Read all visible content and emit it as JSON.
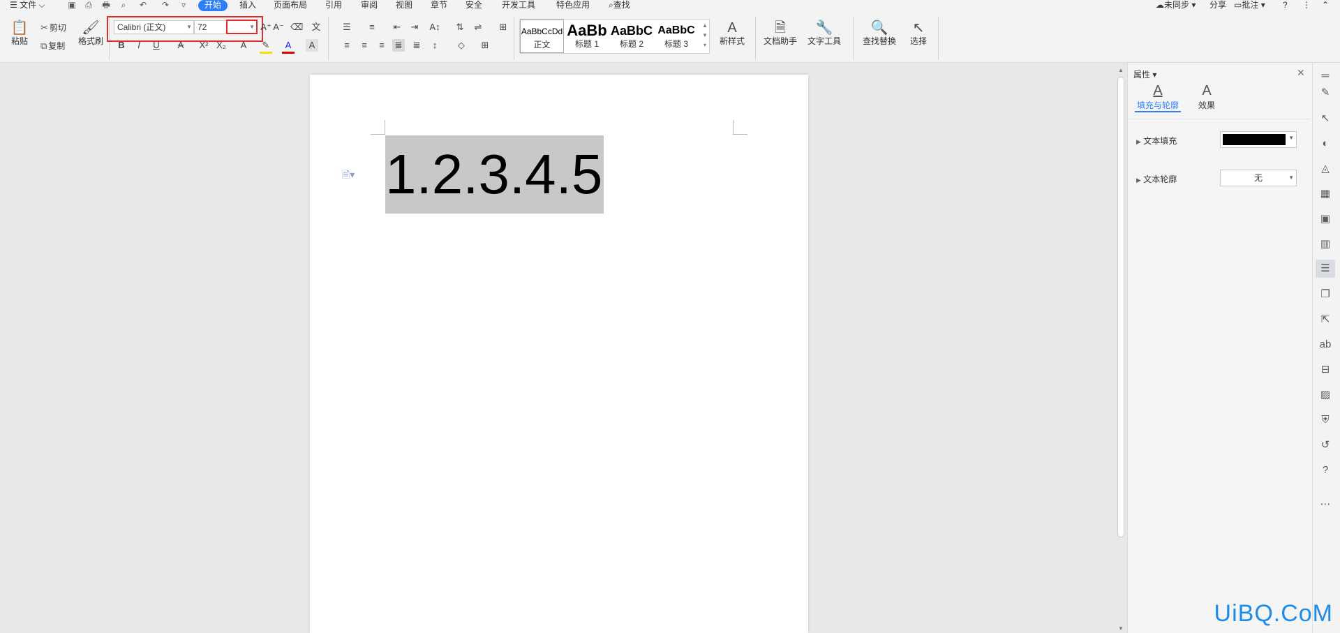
{
  "menu": {
    "file": "文件",
    "tabs": [
      "开始",
      "插入",
      "页面布局",
      "引用",
      "审阅",
      "视图",
      "章节",
      "安全",
      "开发工具",
      "特色应用"
    ],
    "search": "查找",
    "right": {
      "sync": "未同步",
      "share": "分享",
      "comment": "批注"
    }
  },
  "ribbon": {
    "paste": "粘贴",
    "cut": "剪切",
    "copy": "复制",
    "format_painter": "格式刷",
    "font_name": "Calibri (正文)",
    "font_size": "72",
    "styles": [
      {
        "sample": "AaBbCcDd",
        "name": "正文"
      },
      {
        "sample": "AaBb",
        "name": "标题 1"
      },
      {
        "sample": "AaBbC",
        "name": "标题 2"
      },
      {
        "sample": "AaBbC",
        "name": "标题 3"
      }
    ],
    "new_style": "新样式",
    "doc_assistant": "文档助手",
    "text_tools": "文字工具",
    "find_replace": "查找替换",
    "select": "选择"
  },
  "document": {
    "text": "1.2.3.4.5"
  },
  "properties": {
    "title": "属性",
    "tab_fill": "填充与轮廓",
    "tab_effect": "效果",
    "text_fill": "文本填充",
    "text_fill_color": "#000000",
    "text_outline": "文本轮廓",
    "text_outline_value": "无"
  },
  "watermark": "UiBQ.CoM",
  "colors": {
    "accent": "#2e7ef5",
    "highlight_box": "#e32b2b"
  }
}
